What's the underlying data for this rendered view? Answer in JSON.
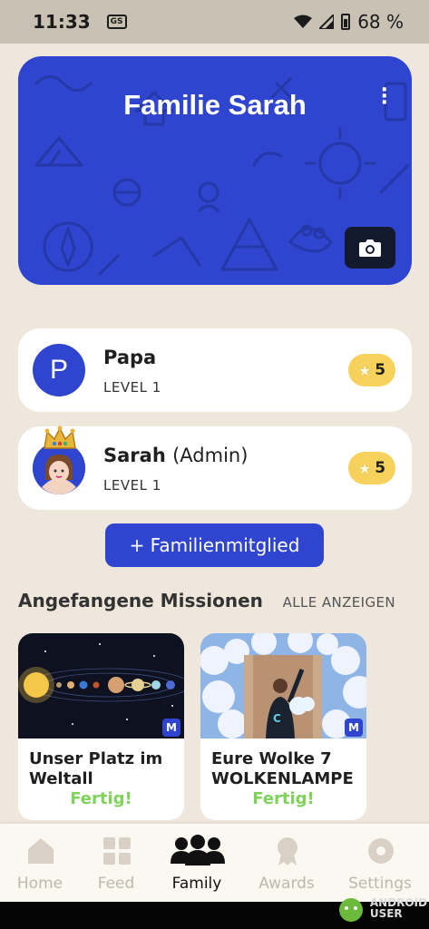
{
  "status_bar": {
    "time": "11:33",
    "notif_badge": "GS",
    "battery": "68 %"
  },
  "banner": {
    "title": "Familie Sarah",
    "menu_icon": "more-vert-icon",
    "camera_icon": "camera-icon",
    "color": "#2f45cf"
  },
  "members": [
    {
      "initial": "P",
      "name": "Papa",
      "role": "",
      "level": "LEVEL 1",
      "points": "5"
    },
    {
      "initial": "",
      "name": "Sarah",
      "role": "(Admin)",
      "level": "LEVEL 1",
      "points": "5",
      "badge": "crown-icon"
    }
  ],
  "add_member_label": "+ Familienmitglied",
  "missions": {
    "title": "Angefangene Missionen",
    "show_all": "ALLE ANZEIGEN",
    "cards": [
      {
        "title": "Unser Platz im Weltall",
        "status": "Fertig!",
        "tag": "M"
      },
      {
        "title": "Eure Wolke 7 WOLKENLAMPE",
        "status": "Fertig!",
        "tag": "M"
      }
    ]
  },
  "nav": [
    {
      "label": "Home",
      "icon": "home-icon",
      "active": false
    },
    {
      "label": "Feed",
      "icon": "grid-icon",
      "active": false
    },
    {
      "label": "Family",
      "icon": "family-icon",
      "active": true
    },
    {
      "label": "Awards",
      "icon": "award-icon",
      "active": false
    },
    {
      "label": "Settings",
      "icon": "gear-icon",
      "active": false
    }
  ],
  "watermark": {
    "line1": "ANDROID",
    "line2": "USER"
  }
}
